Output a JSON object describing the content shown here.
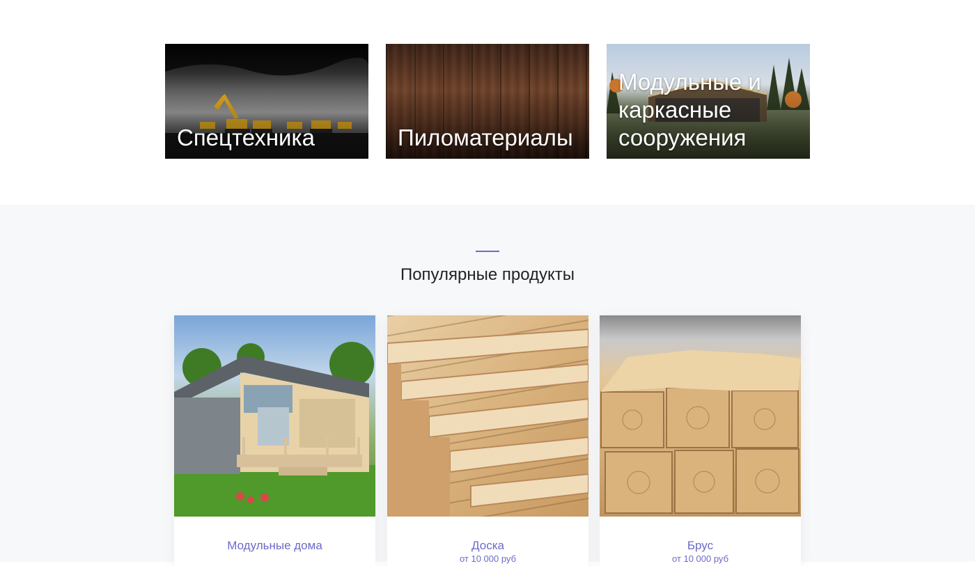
{
  "categories": [
    {
      "title": "Спецтехника"
    },
    {
      "title": "Пиломатериалы"
    },
    {
      "title": "Модульные и каркасные сооружения"
    }
  ],
  "popular": {
    "title": "Популярные продукты",
    "accent_color": "#6a6bc9",
    "products": [
      {
        "name": "Модульные дома",
        "price": ""
      },
      {
        "name": "Доска",
        "price": "от 10 000 руб"
      },
      {
        "name": "Брус",
        "price": "от 10 000 руб"
      }
    ]
  }
}
